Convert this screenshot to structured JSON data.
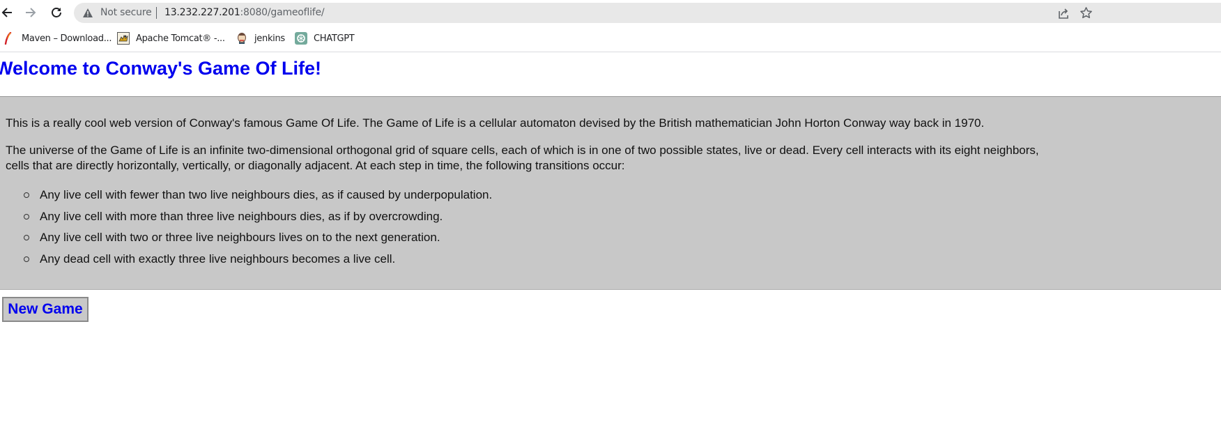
{
  "browser": {
    "security_label": "Not secure",
    "url_host": "13.232.227.201",
    "url_path": ":8080/gameoflife/",
    "icons": {
      "back": "arrow-left-icon",
      "forward": "arrow-right-icon",
      "reload": "reload-icon",
      "security": "warning-triangle-icon",
      "share": "share-icon",
      "bookmark": "star-icon"
    }
  },
  "bookmarks": [
    {
      "label": "Maven – Download...",
      "icon": "maven-feather-icon"
    },
    {
      "label": "Apache Tomcat® -...",
      "icon": "tomcat-icon"
    },
    {
      "label": "jenkins",
      "icon": "jenkins-icon"
    },
    {
      "label": "CHATGPT",
      "icon": "chatgpt-icon"
    }
  ],
  "page": {
    "heading": "Welcome to Conway's Game Of Life!",
    "intro": "This is a really cool web version of Conway's famous Game Of Life. The Game of Life is a cellular automaton devised by the British mathematician John Horton Conway way back in 1970.",
    "universe_line_1": "The universe of the Game of Life is an infinite two-dimensional orthogonal grid of square cells, each of which is in one of two possible states, live or dead. Every cell interacts with its eight neighbors,",
    "universe_line_2": "cells that are directly horizontally, vertically, or diagonally adjacent. At each step in time, the following transitions occur:",
    "rules": [
      "Any live cell with fewer than two live neighbours dies, as if caused by underpopulation.",
      "Any live cell with more than three live neighbours dies, as if by overcrowding.",
      "Any live cell with two or three live neighbours lives on to the next generation.",
      "Any dead cell with exactly three live neighbours becomes a live cell."
    ],
    "new_game_label": "New Game"
  },
  "colors": {
    "heading": "#0000ee",
    "panel_background": "#c8c8c8",
    "omnibox": "#e8e8e8"
  }
}
